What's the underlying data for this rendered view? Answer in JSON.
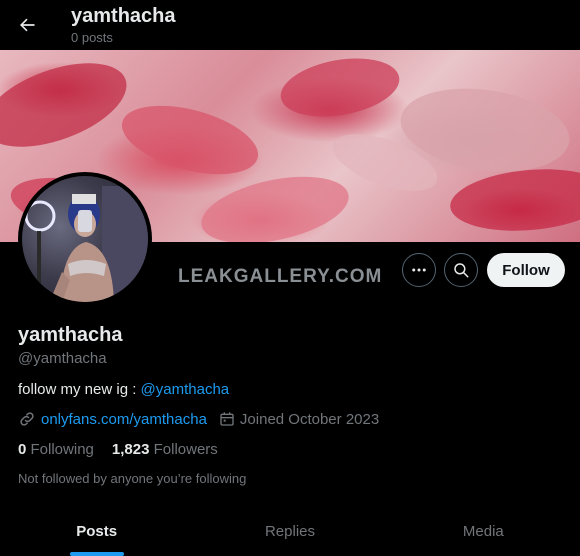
{
  "header": {
    "title": "yamthacha",
    "post_count": "0 posts",
    "back_icon": "arrow-left-icon"
  },
  "banner": {
    "description_colors": [
      "#c8324a",
      "#e8b8bf",
      "#d98d99"
    ]
  },
  "watermark": "LEAKGALLERY.COM",
  "actions": {
    "more_icon": "more-horizontal-icon",
    "search_icon": "search-icon",
    "follow_label": "Follow"
  },
  "profile": {
    "display_name": "yamthacha",
    "handle": "@yamthacha",
    "bio_text": "follow my new ig : ",
    "bio_link": "@yamthacha",
    "website": "onlyfans.com/yamthacha",
    "joined": "Joined October 2023",
    "following_count": "0",
    "following_label": "Following",
    "followers_count": "1,823",
    "followers_label": "Followers",
    "not_followed_text": "Not followed by anyone you’re following"
  },
  "tabs": [
    {
      "label": "Posts",
      "active": true
    },
    {
      "label": "Replies",
      "active": false
    },
    {
      "label": "Media",
      "active": false
    }
  ],
  "colors": {
    "background": "#000000",
    "accent": "#1d9bf0",
    "muted": "#71767b",
    "text": "#e7e9ea"
  }
}
